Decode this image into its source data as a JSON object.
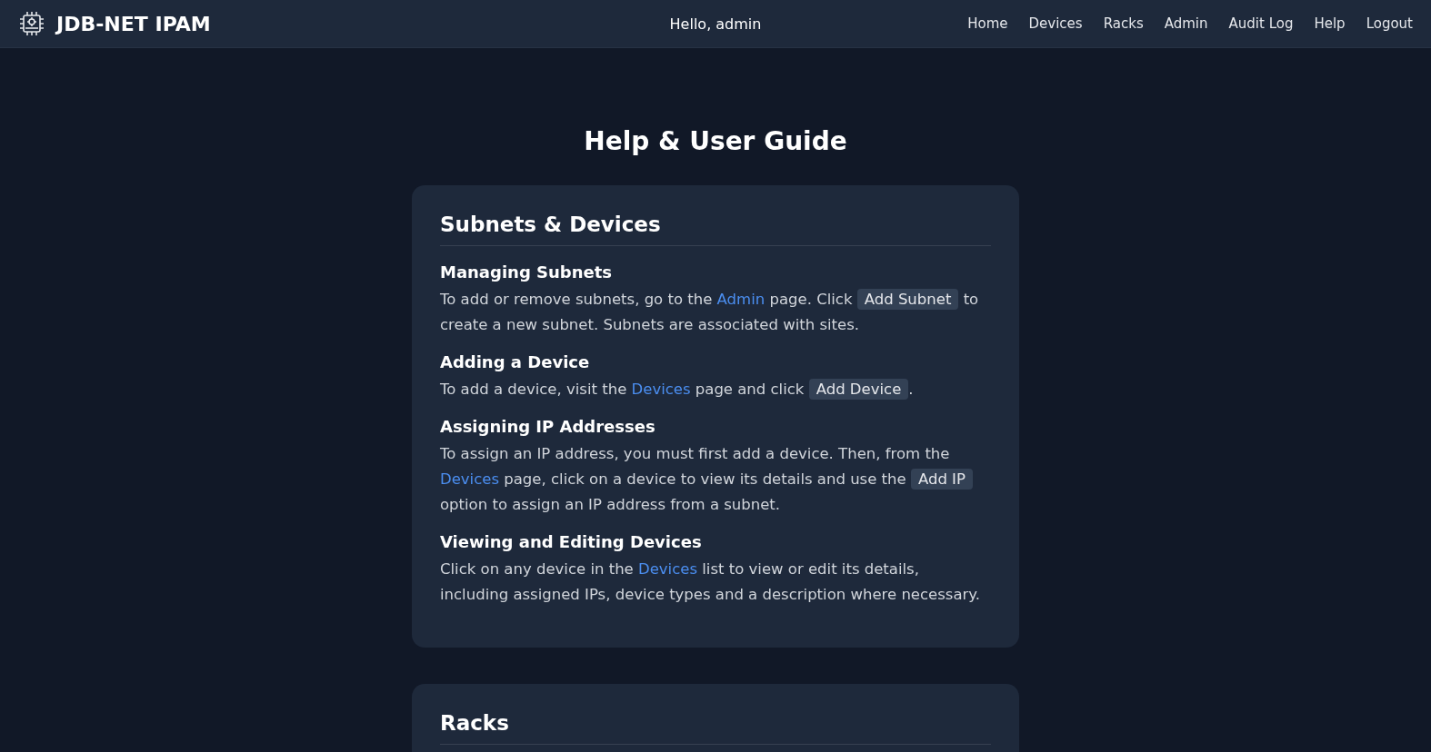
{
  "header": {
    "brand": "JDB-NET IPAM",
    "greeting": "Hello, admin",
    "nav": [
      {
        "label": "Home"
      },
      {
        "label": "Devices"
      },
      {
        "label": "Racks"
      },
      {
        "label": "Admin"
      },
      {
        "label": "Audit Log"
      },
      {
        "label": "Help"
      },
      {
        "label": "Logout"
      }
    ]
  },
  "page_title": "Help & User Guide",
  "sections": [
    {
      "title": "Subnets & Devices",
      "topics": [
        {
          "heading": "Managing Subnets",
          "body": [
            {
              "kind": "text",
              "text": "To add or remove subnets, go to the "
            },
            {
              "kind": "link",
              "text": "Admin"
            },
            {
              "kind": "text",
              "text": " page. Click "
            },
            {
              "kind": "code",
              "text": "Add Subnet"
            },
            {
              "kind": "text",
              "text": " to create a new subnet. Subnets are associated with sites."
            }
          ]
        },
        {
          "heading": "Adding a Device",
          "body": [
            {
              "kind": "text",
              "text": "To add a device, visit the "
            },
            {
              "kind": "link",
              "text": "Devices"
            },
            {
              "kind": "text",
              "text": " page and click "
            },
            {
              "kind": "code",
              "text": "Add Device"
            },
            {
              "kind": "text",
              "text": "."
            }
          ]
        },
        {
          "heading": "Assigning IP Addresses",
          "body": [
            {
              "kind": "text",
              "text": "To assign an IP address, you must first add a device. Then, from the "
            },
            {
              "kind": "link",
              "text": "Devices"
            },
            {
              "kind": "text",
              "text": " page, click on a device to view its details and use the "
            },
            {
              "kind": "code",
              "text": "Add IP"
            },
            {
              "kind": "text",
              "text": " option to assign an IP address from a subnet."
            }
          ]
        },
        {
          "heading": "Viewing and Editing Devices",
          "body": [
            {
              "kind": "text",
              "text": "Click on any device in the "
            },
            {
              "kind": "link",
              "text": "Devices"
            },
            {
              "kind": "text",
              "text": " list to view or edit its details, including assigned IPs, device types and a description where necessary."
            }
          ]
        }
      ]
    },
    {
      "title": "Racks"
    }
  ]
}
